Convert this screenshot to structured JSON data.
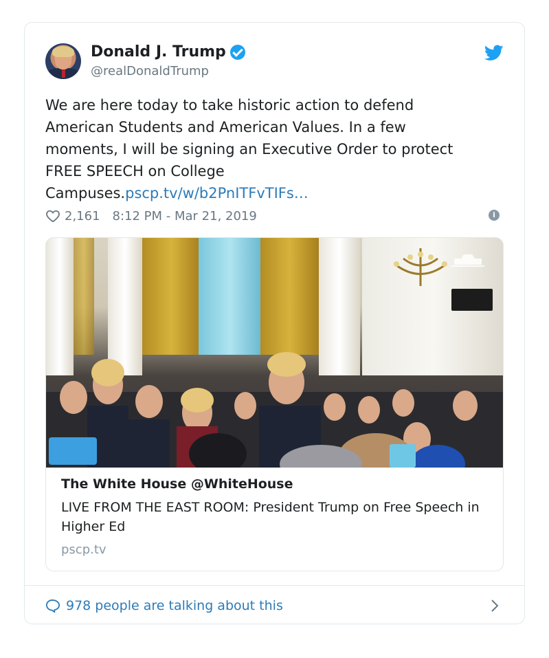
{
  "author": {
    "name": "Donald J. Trump",
    "handle": "@realDonaldTrump",
    "verified": true
  },
  "tweet": {
    "text_lines": [
      "We are here today to take historic action to defend",
      "American Students and American Values. In a few",
      "moments, I will be signing an Executive Order to protect",
      "FREE SPEECH on College"
    ],
    "last_line_prefix": "Campuses.",
    "link_text": "pscp.tv/w/b2PnITFvTIFs…"
  },
  "meta": {
    "likes": "2,161",
    "timestamp": "8:12 PM - Mar 21, 2019"
  },
  "media_card": {
    "title": "The White House @WhiteHouse",
    "description": "LIVE FROM THE EAST ROOM: President Trump on Free Speech in Higher Ed",
    "domain": "pscp.tv"
  },
  "footer": {
    "conversation": "978 people are talking about this"
  },
  "colors": {
    "twitter_blue": "#1da1f2",
    "link_blue": "#2b7bb9",
    "muted_gray": "#697882",
    "border": "#e1e8ed"
  },
  "icons": [
    "twitter-bird-icon",
    "verified-badge-icon",
    "heart-icon",
    "info-icon",
    "comment-icon",
    "chevron-right-icon"
  ]
}
